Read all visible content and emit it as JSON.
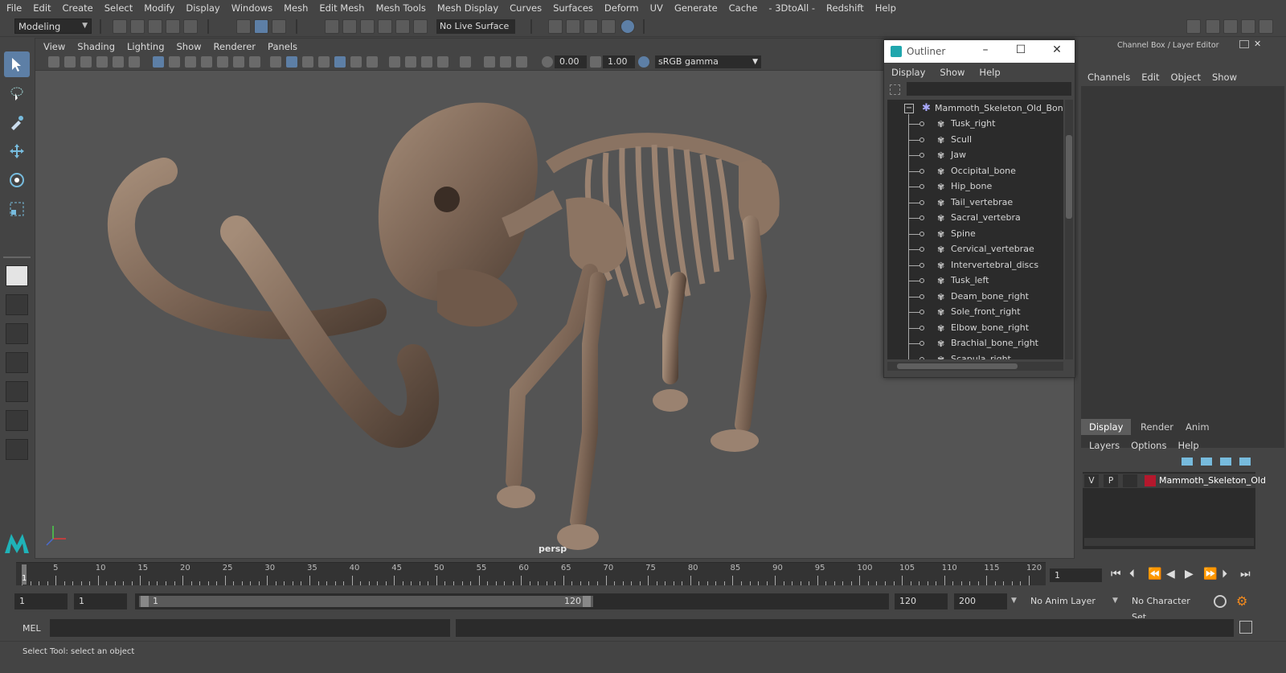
{
  "menubar": [
    "File",
    "Edit",
    "Create",
    "Select",
    "Modify",
    "Display",
    "Windows",
    "Mesh",
    "Edit Mesh",
    "Mesh Tools",
    "Mesh Display",
    "Curves",
    "Surfaces",
    "Deform",
    "UV",
    "Generate",
    "Cache",
    "- 3DtoAll -",
    "Redshift",
    "Help"
  ],
  "status_line": {
    "mode": "Modeling",
    "live_surface": "No Live Surface"
  },
  "viewport": {
    "panel_menu": [
      "View",
      "Shading",
      "Lighting",
      "Show",
      "Renderer",
      "Panels"
    ],
    "exposure": "0.00",
    "gamma": "1.00",
    "color_space": "sRGB gamma",
    "camera": "persp"
  },
  "outliner": {
    "title": "Outliner",
    "menu": [
      "Display",
      "Show",
      "Help"
    ],
    "root": "Mammoth_Skeleton_Old_Bones",
    "items": [
      "Tusk_right",
      "Scull",
      "Jaw",
      "Occipital_bone",
      "Hip_bone",
      "Tail_vertebrae",
      "Sacral_vertebra",
      "Spine",
      "Cervical_vertebrae",
      "Intervertebral_discs",
      "Tusk_left",
      "Deam_bone_right",
      "Sole_front_right",
      "Elbow_bone_right",
      "Brachial_bone_right",
      "Scapula_right"
    ]
  },
  "channel_box": {
    "title": "Channel Box / Layer Editor",
    "menu": [
      "Channels",
      "Edit",
      "Object",
      "Show"
    ],
    "tabs": [
      "Display",
      "Render",
      "Anim"
    ],
    "layer_menu": [
      "Layers",
      "Options",
      "Help"
    ],
    "layer": {
      "v": "V",
      "p": "P",
      "name": "Mammoth_Skeleton_Old",
      "color": "#b5182d"
    }
  },
  "time_slider": {
    "labels": [
      "5",
      "10",
      "15",
      "20",
      "25",
      "30",
      "35",
      "40",
      "45",
      "50",
      "55",
      "60",
      "65",
      "70",
      "75",
      "80",
      "85",
      "90",
      "95",
      "100",
      "105",
      "110",
      "115",
      "120"
    ],
    "current_marker": "1",
    "current_frame": "1"
  },
  "range_slider": {
    "start": "1",
    "playback_start": "1",
    "bar_start": "1",
    "bar_end": "120",
    "playback_end": "120",
    "end": "200",
    "anim_layer": "No Anim Layer",
    "char_set": "No Character Set"
  },
  "command_line": {
    "label": "MEL"
  },
  "help_line": "Select Tool: select an object",
  "colors": {
    "accent": "#5d7fa6",
    "bg": "#444444",
    "viewport": "#545454"
  }
}
